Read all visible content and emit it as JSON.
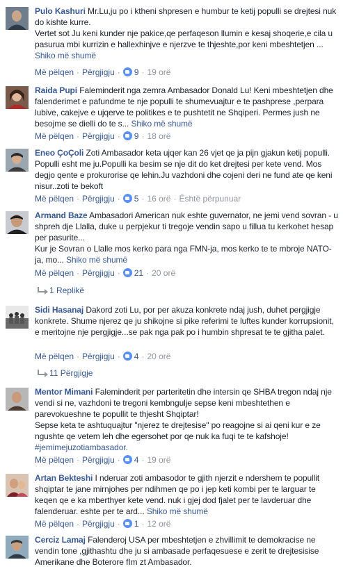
{
  "labels": {
    "like": "Më pëlqen",
    "reply": "Përgjigju",
    "see_more": "Shiko më shumë"
  },
  "comments": [
    {
      "author": "Pulo Kashuri",
      "text": "Mr.Lu,ju po i ktheni shpresen e humbur te ketij populli se drejtesi nuk do kishte kurre.\nVertet sot Ju keni kunder nje pakice,qe perfaqeson llumin e kesaj shoqerie,e cila u pasurua mbi kurrizin e hallexhinjve e njerzve te thjeshte,por keni mbeshtetjen ...",
      "likes": "9",
      "time": "19 orë",
      "edited": "",
      "replies": ""
    },
    {
      "author": "Raida Pupi",
      "text": "Faleminderit nga zemra Ambasador Donald Lu! Keni mbeshtetjen dhe falenderimet e pafundme te nje populli te shumevuajtur e te pashprese ,perpara lubive, cakejve e ujqerve te politikes e te pushtetit ne Shqiperi. Permes jush ne besojme se dielli do te s...",
      "likes": "9",
      "time": "18 orë",
      "edited": "",
      "replies": ""
    },
    {
      "author": "Eneo ÇoÇoli",
      "text": "Zoti Ambasador keta ujqer kan 26 vjet qe ja pijn gjakun ketij populli. Populli esht me ju.Populli ka besim se nje dit do ket drejtesi per kete vend. Mos degjo qente e prokurorise qe lehin.Ju vazhdoni dhe cojeni deri ne fund ate qe keni nisur..zoti te bekoft",
      "likes": "5",
      "time": "16 orë",
      "edited": "Është përpunuar",
      "replies": ""
    },
    {
      "author": "Armand Baze",
      "text": "Ambasadori American nuk eshte guvernator, ne jemi vend sovran - u shpreh dje Llalla, duke u perpjekur ti tregoje vendin sapo u fillua tu kerkohet hesap per pasurite...\nKur je Sovran o Llalle mos kerko para nga FMN-ja, mos kerko te te mbroje NATO-ja, mo...",
      "likes": "21",
      "time": "20 orë",
      "edited": "",
      "replies": "1 Replikë"
    },
    {
      "author": "Sidi Hasanaj",
      "text": "Dakord zoti Lu, por per akuza konkrete ndaj jush, duhet pergjigje konkrete. Shume njerez qe ju shikojne si pike referimi te luftes kunder korrupsionit, e meritojne nje pergjigje...se pak nga pak po i humbin shpresat te te gjitha palet.",
      "likes": "4",
      "time": "20 orë",
      "edited": "",
      "replies": "11 Përgjigje"
    },
    {
      "author": "Mentor Mimani",
      "text": "Faleminderit per parteritetin dhe intersin qe SHBA tregon ndaj nje vendi si ne, vazhdoni te tregoni kembngulje sepse keni mbeshtethen e parevokueshne te popullit te thjesht Shqiptar!\nSepse keta te ashtuquajtur \"njerez te drejtesise\" po reagojne si ai qeni kur e ze ngushte qe vetem leh dhe egersohet por qe nuk ka fuqi te te kafshoje!",
      "tag": "#jemimejuzotiambasador.",
      "likes": "4",
      "time": "19 orë",
      "edited": "",
      "replies": ""
    },
    {
      "author": "Artan Bekteshi",
      "text": "I nderuar zoti ambasodor te gjith njerzit e ndershem te popullit shqiptar te jane mirnjohes per ndihmen qe po i jep keti kombi per te larguar te keqen qe e ka mberthyer kete vend. nuk i gjej dod fjalet per te lavderuar dhe falenderuar. eshte per te ard...",
      "likes": "1",
      "time": "12 orë",
      "edited": "",
      "replies": ""
    },
    {
      "author": "Cerciz Lamaj",
      "text": "Falenderoj USA per mbeshtetjen e zhvillimit te demokracise ne vendin tone ,gjithashtu dhe ju si ambasade perfaqesuese e zerit te drejtesisise Amerikane dhe Boterore fIm zt Ambasador.",
      "likes": "",
      "time": "",
      "edited": "",
      "replies": ""
    }
  ],
  "colors": {
    "link": "#365899",
    "meta": "#90949c",
    "like_badge": "#5890ff"
  }
}
